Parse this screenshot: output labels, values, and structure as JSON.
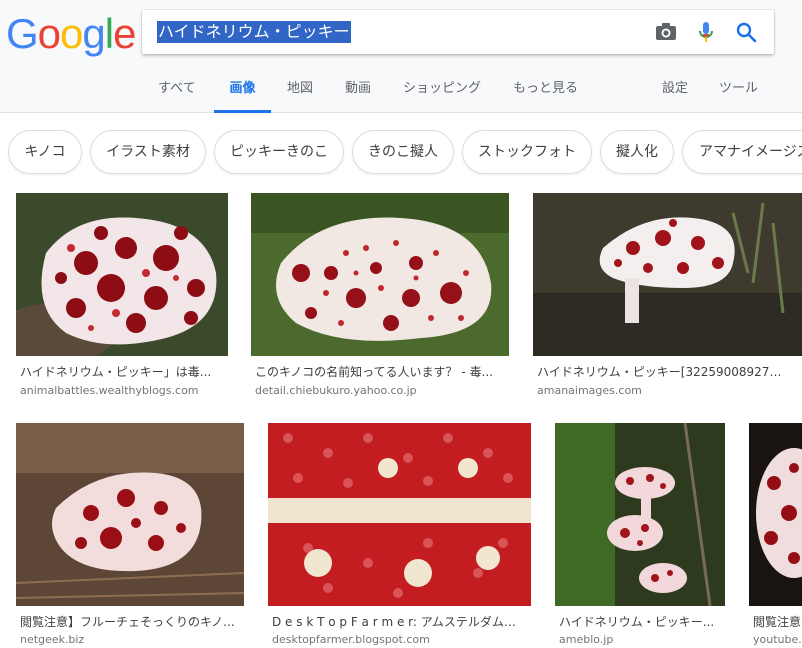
{
  "logo": {
    "letters": [
      "G",
      "o",
      "o",
      "g",
      "l",
      "e"
    ],
    "colors": [
      "#4285f4",
      "#ea4335",
      "#fbbc05",
      "#4285f4",
      "#34a853",
      "#ea4335"
    ]
  },
  "search": {
    "query": "ハイドネリウム・ピッキー"
  },
  "tabs": {
    "all": "すべて",
    "images": "画像",
    "maps": "地図",
    "videos": "動画",
    "shopping": "ショッピング",
    "more": "もっと見る",
    "settings": "設定",
    "tools": "ツール"
  },
  "chips": [
    "キノコ",
    "イラスト素材",
    "ピッキーきのこ",
    "きのこ擬人",
    "ストックフォト",
    "擬人化",
    "アマナイメージズ"
  ],
  "results": [
    {
      "title": "ハイドネリウム・ピッキー」は毒...",
      "site": "animalbattles.wealthyblogs.com"
    },
    {
      "title": "このキノコの名前知ってる人います？ - 毒...",
      "site": "detail.chiebukuro.yahoo.co.jp"
    },
    {
      "title": "ハイドネリウム・ピッキー[32259008927]...",
      "site": "amanaimages.com"
    },
    {
      "title": "閲覧注意】フルーチェそっくりのキノ...",
      "site": "netgeek.biz"
    },
    {
      "title": "D e s k T o p F a r m e r: アムステルダムの...",
      "site": "desktopfarmer.blogspot.com"
    },
    {
      "title": "ハイドネリウム・ピッキー...",
      "site": "ameblo.jp"
    },
    {
      "title": "閲覧注意",
      "site": "youtube.co"
    }
  ],
  "colors": {
    "accent": "#1a73e8",
    "selection": "#3166c7",
    "mushroom": "#f2e6e6",
    "droplet": "#9b0d12"
  }
}
